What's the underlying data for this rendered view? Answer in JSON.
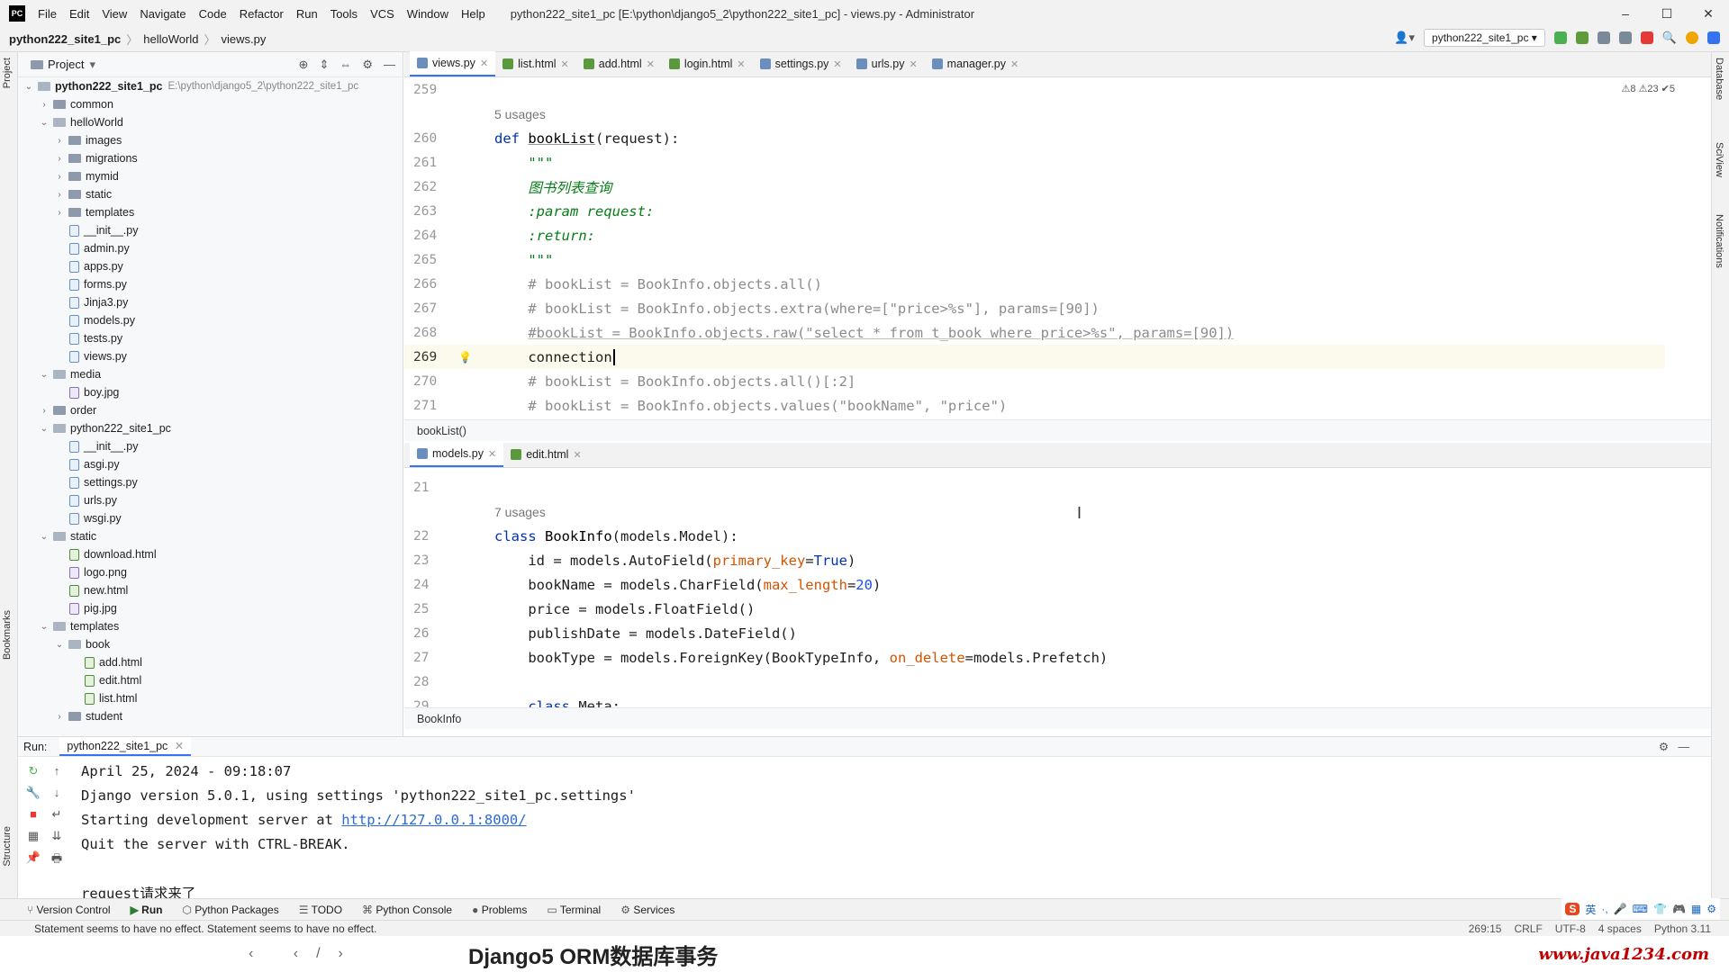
{
  "titlebar": {
    "menu": [
      "File",
      "Edit",
      "View",
      "Navigate",
      "Code",
      "Refactor",
      "Run",
      "Tools",
      "VCS",
      "Window",
      "Help"
    ],
    "title": "python222_site1_pc [E:\\python\\django5_2\\python222_site1_pc] - views.py - Administrator",
    "controls": [
      "–",
      "☐",
      "✕"
    ]
  },
  "navbar": {
    "crumbs": [
      "python222_site1_pc",
      "helloWorld",
      "views.py"
    ],
    "run_config": "python222_site1_pc"
  },
  "project": {
    "title": "Project",
    "root_name": "python222_site1_pc",
    "root_path": "E:\\python\\django5_2\\python222_site1_pc",
    "items": [
      {
        "label": "common",
        "type": "folder",
        "depth": 1,
        "chev": "›"
      },
      {
        "label": "helloWorld",
        "type": "folder",
        "depth": 1,
        "chev": "⌄"
      },
      {
        "label": "images",
        "type": "folder",
        "depth": 2,
        "chev": "›"
      },
      {
        "label": "migrations",
        "type": "folder",
        "depth": 2,
        "chev": "›"
      },
      {
        "label": "mymid",
        "type": "folder",
        "depth": 2,
        "chev": "›"
      },
      {
        "label": "static",
        "type": "folder",
        "depth": 2,
        "chev": "›"
      },
      {
        "label": "templates",
        "type": "folder",
        "depth": 2,
        "chev": "›"
      },
      {
        "label": "__init__.py",
        "type": "py",
        "depth": 2
      },
      {
        "label": "admin.py",
        "type": "py",
        "depth": 2
      },
      {
        "label": "apps.py",
        "type": "py",
        "depth": 2
      },
      {
        "label": "forms.py",
        "type": "py",
        "depth": 2
      },
      {
        "label": "Jinja3.py",
        "type": "py",
        "depth": 2
      },
      {
        "label": "models.py",
        "type": "py",
        "depth": 2
      },
      {
        "label": "tests.py",
        "type": "py",
        "depth": 2
      },
      {
        "label": "views.py",
        "type": "py",
        "depth": 2
      },
      {
        "label": "media",
        "type": "folder",
        "depth": 1,
        "chev": "⌄"
      },
      {
        "label": "boy.jpg",
        "type": "img",
        "depth": 2
      },
      {
        "label": "order",
        "type": "folder",
        "depth": 1,
        "chev": "›"
      },
      {
        "label": "python222_site1_pc",
        "type": "folder",
        "depth": 1,
        "chev": "⌄"
      },
      {
        "label": "__init__.py",
        "type": "py",
        "depth": 2
      },
      {
        "label": "asgi.py",
        "type": "py",
        "depth": 2
      },
      {
        "label": "settings.py",
        "type": "py",
        "depth": 2
      },
      {
        "label": "urls.py",
        "type": "py",
        "depth": 2
      },
      {
        "label": "wsgi.py",
        "type": "py",
        "depth": 2
      },
      {
        "label": "static",
        "type": "folder",
        "depth": 1,
        "chev": "⌄"
      },
      {
        "label": "download.html",
        "type": "html",
        "depth": 2
      },
      {
        "label": "logo.png",
        "type": "img",
        "depth": 2
      },
      {
        "label": "new.html",
        "type": "html",
        "depth": 2
      },
      {
        "label": "pig.jpg",
        "type": "img",
        "depth": 2
      },
      {
        "label": "templates",
        "type": "folder",
        "depth": 1,
        "chev": "⌄"
      },
      {
        "label": "book",
        "type": "folder",
        "depth": 2,
        "chev": "⌄"
      },
      {
        "label": "add.html",
        "type": "html",
        "depth": 3
      },
      {
        "label": "edit.html",
        "type": "html",
        "depth": 3
      },
      {
        "label": "list.html",
        "type": "html",
        "depth": 3
      },
      {
        "label": "student",
        "type": "folder",
        "depth": 2,
        "chev": "›"
      }
    ]
  },
  "editor1": {
    "tabs": [
      "views.py",
      "list.html",
      "add.html",
      "login.html",
      "settings.py",
      "urls.py",
      "manager.py"
    ],
    "active": 0,
    "warnings": "⚠8  ⚠23  ✔5",
    "breadcrumb": "bookList()",
    "lines": [
      {
        "n": "259",
        "html": ""
      },
      {
        "n": "",
        "html": "<span class='usage'>5 usages</span>"
      },
      {
        "n": "260",
        "html": "<span class='kw'>def</span> <span class='fn'>bookList</span>(request):"
      },
      {
        "n": "261",
        "html": "    <span class='doc'>\"\"\"</span>"
      },
      {
        "n": "262",
        "html": "    <span class='doc'>图书列表查询</span>"
      },
      {
        "n": "263",
        "html": "    <span class='doc'>:param request:</span>"
      },
      {
        "n": "264",
        "html": "    <span class='doc'>:return:</span>"
      },
      {
        "n": "265",
        "html": "    <span class='doc'>\"\"\"</span>"
      },
      {
        "n": "266",
        "html": "    <span class='cm'># bookList = BookInfo.objects.all()</span>"
      },
      {
        "n": "267",
        "html": "    <span class='cm'># bookList = BookInfo.objects.extra(where=[\"price>%s\"], params=[90])</span>"
      },
      {
        "n": "268",
        "html": "    <span class='cm' style='text-decoration:underline;text-decoration-color:#c0c0c0'>#bookList = BookInfo.objects.raw(\"select * from t_book where price>%s\", params=[90])</span>"
      },
      {
        "n": "269",
        "html": "    connection<span style='border-left:2px solid #000;margin-left:1px'></span>",
        "current": true
      },
      {
        "n": "270",
        "html": "    <span class='cm'># bookList = BookInfo.objects.all()[:2]</span>"
      },
      {
        "n": "271",
        "html": "    <span class='cm'># bookList = BookInfo.objects.values(\"bookName\", \"price\")</span>"
      }
    ]
  },
  "editor2": {
    "tabs": [
      "models.py",
      "edit.html"
    ],
    "active": 0,
    "breadcrumb": "BookInfo",
    "lines": [
      {
        "n": "21",
        "html": ""
      },
      {
        "n": "",
        "html": "<span class='usage'>7 usages</span>"
      },
      {
        "n": "22",
        "html": "<span class='kw'>class</span> <span class='fn' style='text-decoration:none'>BookInfo</span>(models.Model):"
      },
      {
        "n": "23",
        "html": "    id = models.AutoField(<span class='param'>primary_key</span>=<span class='kw'>True</span>)"
      },
      {
        "n": "24",
        "html": "    bookName = models.CharField(<span class='param'>max_length</span>=<span class='num'>20</span>)"
      },
      {
        "n": "25",
        "html": "    price = models.FloatField()"
      },
      {
        "n": "26",
        "html": "    publishDate = models.DateField()"
      },
      {
        "n": "27",
        "html": "    bookType = models.ForeignKey(BookTypeInfo, <span class='param'>on_delete</span>=models.Prefetch)"
      },
      {
        "n": "28",
        "html": ""
      },
      {
        "n": "29",
        "html": "    <span class='kw'>class</span> Meta:"
      }
    ]
  },
  "run": {
    "label": "Run:",
    "tab": "python222_site1_pc",
    "lines": [
      "April 25, 2024 - 09:18:07",
      "Django version 5.0.1, using settings 'python222_site1_pc.settings'",
      "Starting development server at ",
      "Quit the server with CTRL-BREAK.",
      "",
      "request请求来了"
    ],
    "link": "http://127.0.0.1:8000/"
  },
  "bottom_tabs": [
    "Version Control",
    "Run",
    "Python Packages",
    "TODO",
    "Python Console",
    "Problems",
    "Terminal",
    "Services"
  ],
  "status": {
    "message": "Statement seems to have no effect. Statement seems to have no effect.",
    "position": "269:15",
    "line_ending": "CRLF",
    "encoding": "UTF-8",
    "indent": "4 spaces",
    "interpreter": "Python 3.11"
  },
  "left_tools": [
    "Project",
    "Bookmarks",
    "Structure"
  ],
  "right_tools": [
    "Database",
    "SciView",
    "Notifications"
  ],
  "ime": [
    "S",
    "英",
    "·,",
    "🎤",
    "⌨",
    "👕",
    "🎮",
    "▦",
    "⚙"
  ],
  "caption": {
    "title": "Django5 ORM数据库事务",
    "site": "www.java1234.com"
  }
}
